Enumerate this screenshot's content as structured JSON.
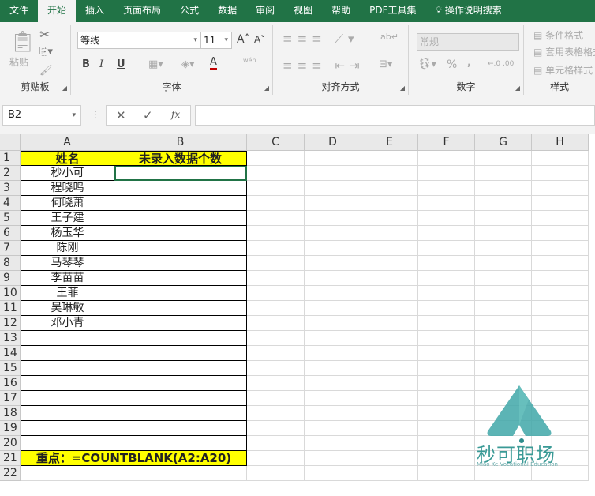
{
  "tabs": [
    "文件",
    "开始",
    "插入",
    "页面布局",
    "公式",
    "数据",
    "审阅",
    "视图",
    "帮助",
    "PDF工具集",
    "操作说明搜索"
  ],
  "ribbon": {
    "clipboard": {
      "label": "剪贴板",
      "paste": "粘贴"
    },
    "font": {
      "label": "字体",
      "name": "等线",
      "size": "11",
      "bold": "B",
      "italic": "I",
      "underline": "U",
      "color_a": "A",
      "phonetic": "wén"
    },
    "align": {
      "label": "对齐方式"
    },
    "number": {
      "label": "数字",
      "format": "常规",
      "percent": "%",
      "comma": ","
    },
    "styles": {
      "label": "样式",
      "cond": "条件格式",
      "table": "套用表格格式",
      "cell": "单元格样式"
    }
  },
  "formula_bar": {
    "name_box": "B2",
    "fx": "fx",
    "value": ""
  },
  "columns": [
    "A",
    "B",
    "C",
    "D",
    "E",
    "F",
    "G",
    "H"
  ],
  "header_row": {
    "A": "姓名",
    "B": "未录入数据个数"
  },
  "names": [
    "秒小可",
    "程晓鸣",
    "何晓萧",
    "王子建",
    "杨玉华",
    "陈刚",
    "马琴琴",
    "李苗苗",
    "王菲",
    "吴琳敏",
    "邓小青"
  ],
  "rows": [
    "1",
    "2",
    "3",
    "4",
    "5",
    "6",
    "7",
    "8",
    "9",
    "10",
    "11",
    "12",
    "13",
    "14",
    "15",
    "16",
    "17",
    "18",
    "19",
    "20",
    "21",
    "22"
  ],
  "note": "重点：=COUNTBLANK(A2:A20)",
  "logo": {
    "text": "秒可职场",
    "sub": "Miao Ke Vocational Education"
  },
  "colors": {
    "accent": "#217346",
    "highlight": "#ffff00"
  }
}
